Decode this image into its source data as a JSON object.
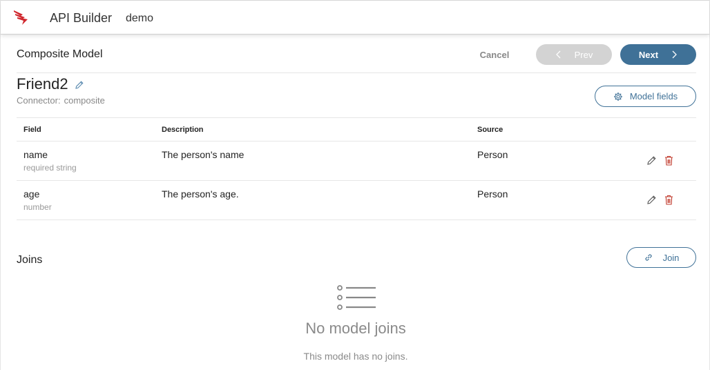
{
  "header": {
    "app_title": "API Builder",
    "project_name": "demo",
    "logo_icon": "axway-logo-icon"
  },
  "page": {
    "title": "Composite Model",
    "cancel_label": "Cancel",
    "prev_label": "Prev",
    "next_label": "Next"
  },
  "model": {
    "name": "Friend2",
    "connector_label": "Connector:",
    "connector_value": "composite",
    "model_fields_label": "Model fields"
  },
  "fields_table": {
    "columns": [
      "Field",
      "Description",
      "Source"
    ],
    "rows": [
      {
        "name": "name",
        "type": "required string",
        "description": "The person's name",
        "source": "Person"
      },
      {
        "name": "age",
        "type": "number",
        "description": "The person's age.",
        "source": "Person"
      }
    ]
  },
  "joins": {
    "title": "Joins",
    "join_label": "Join",
    "empty_title": "No model joins",
    "empty_text": "This model has no joins."
  },
  "colors": {
    "primary": "#3f7197",
    "disabled": "#d3d3d3",
    "delete": "#c0392b",
    "brand": "#d0272d"
  }
}
